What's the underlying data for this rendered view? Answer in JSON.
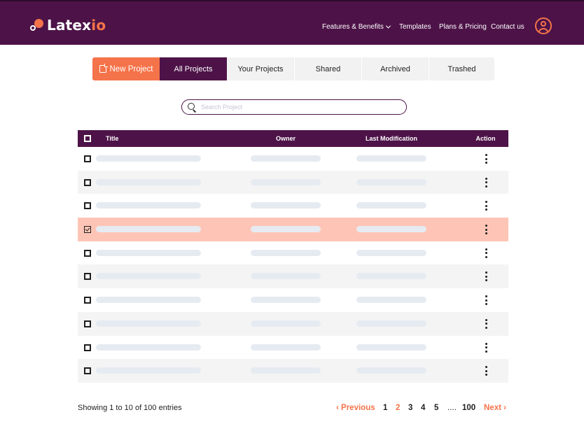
{
  "brand": {
    "name_start": "Latex",
    "name_end": "io",
    "accent_color": "#f5734a",
    "primary_color": "#4d1348"
  },
  "nav": {
    "features": "Features & Benefits",
    "templates": "Templates",
    "plans": "Plans & Pricing",
    "contact": "Contact us"
  },
  "tabs": {
    "new_project": "New Project",
    "all": "All Projects",
    "your": "Your Projects",
    "shared": "Shared",
    "archived": "Archived",
    "trashed": "Trashed",
    "active": "All Projects"
  },
  "search": {
    "placeholder": "Search Project",
    "value": ""
  },
  "table": {
    "columns": {
      "title": "Title",
      "owner": "Owner",
      "modified": "Last Modification",
      "action": "Action"
    },
    "rows": [
      {
        "checked": false
      },
      {
        "checked": false
      },
      {
        "checked": false
      },
      {
        "checked": true
      },
      {
        "checked": false
      },
      {
        "checked": false
      },
      {
        "checked": false
      },
      {
        "checked": false
      },
      {
        "checked": false
      },
      {
        "checked": false
      }
    ]
  },
  "footer": {
    "entries": "Showing 1 to 10 of 100 entries",
    "prev": "Previous",
    "next": "Next",
    "pages": {
      "p1": "1",
      "p2": "2",
      "p3": "3",
      "p4": "4",
      "p5": "5",
      "dots": "....",
      "p100": "100"
    },
    "current_page": 2
  }
}
